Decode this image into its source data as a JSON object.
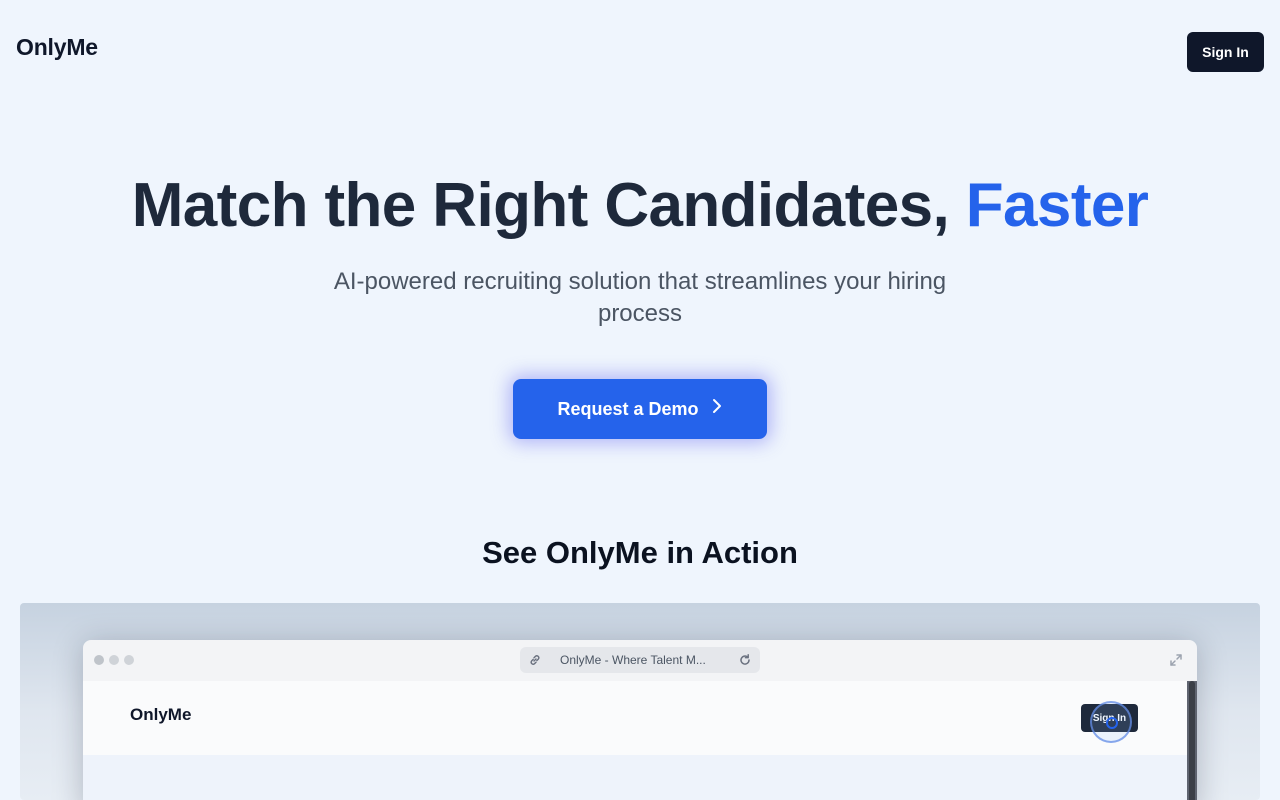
{
  "header": {
    "logo": "OnlyMe",
    "signin_label": "Sign In"
  },
  "hero": {
    "title_main": "Match the Right Candidates,",
    "title_accent": "Faster",
    "subtitle": "AI-powered recruiting solution that streamlines your hiring process",
    "cta_label": "Request a Demo"
  },
  "demo_section": {
    "title": "See OnlyMe in Action",
    "browser": {
      "tab_title": "OnlyMe - Where Talent M...",
      "page_logo": "OnlyMe",
      "page_signin_label": "Sign In"
    }
  },
  "colors": {
    "accent": "#2563eb",
    "dark": "#0f172a",
    "background": "#eff5fd"
  },
  "icons": {
    "cta": "chevron-right-icon",
    "url_left": "link-icon",
    "url_right": "reload-icon",
    "window": "expand-icon"
  }
}
